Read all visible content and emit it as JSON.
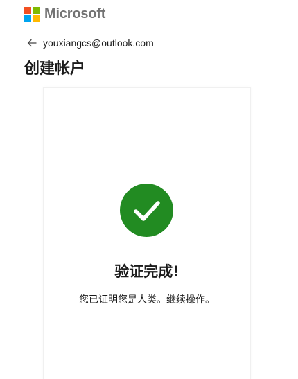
{
  "brand": {
    "name": "Microsoft",
    "logo_colors": [
      "#f25022",
      "#7fba00",
      "#00a4ef",
      "#ffb900"
    ]
  },
  "identity": {
    "email": "youxiangcs@outlook.com",
    "back_icon": "arrow-left-icon"
  },
  "page": {
    "title": "创建帐户"
  },
  "verification": {
    "icon": "checkmark-icon",
    "icon_color": "#228b22",
    "title": "验证完成!",
    "message": "您已证明您是人类。继续操作。"
  }
}
